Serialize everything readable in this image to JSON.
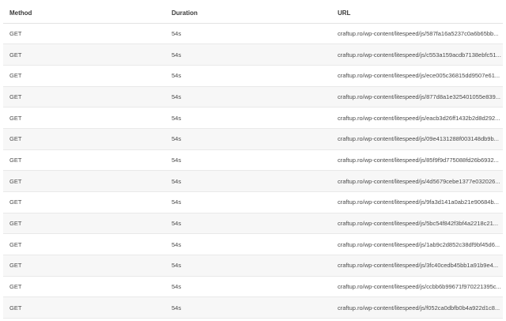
{
  "table": {
    "headers": {
      "method": "Method",
      "duration": "Duration",
      "url": "URL"
    },
    "rows": [
      {
        "method": "GET",
        "duration": "54s",
        "url": "craftup.ro/wp-content/litespeed/js/587fa16a5237c0a6b65bb..."
      },
      {
        "method": "GET",
        "duration": "54s",
        "url": "craftup.ro/wp-content/litespeed/js/c553a159acdb7138ebfc51..."
      },
      {
        "method": "GET",
        "duration": "54s",
        "url": "craftup.ro/wp-content/litespeed/js/ece005c36815dd9507e61..."
      },
      {
        "method": "GET",
        "duration": "54s",
        "url": "craftup.ro/wp-content/litespeed/js/877d8a1e325401055e839..."
      },
      {
        "method": "GET",
        "duration": "54s",
        "url": "craftup.ro/wp-content/litespeed/js/eacb3d26ff1432b2d8d292..."
      },
      {
        "method": "GET",
        "duration": "54s",
        "url": "craftup.ro/wp-content/litespeed/js/09e4131288f003148db9b..."
      },
      {
        "method": "GET",
        "duration": "54s",
        "url": "craftup.ro/wp-content/litespeed/js/85f9f9d775088fd26b6932..."
      },
      {
        "method": "GET",
        "duration": "54s",
        "url": "craftup.ro/wp-content/litespeed/js/4d5679cebe1377e032026..."
      },
      {
        "method": "GET",
        "duration": "54s",
        "url": "craftup.ro/wp-content/litespeed/js/9fa3d141a0ab21e90684b..."
      },
      {
        "method": "GET",
        "duration": "54s",
        "url": "craftup.ro/wp-content/litespeed/js/5bc54f842f3bf4a2218c21..."
      },
      {
        "method": "GET",
        "duration": "54s",
        "url": "craftup.ro/wp-content/litespeed/js/1ab9c2d852c38df9bf45d6..."
      },
      {
        "method": "GET",
        "duration": "54s",
        "url": "craftup.ro/wp-content/litespeed/js/3fc40cedb45bb1a91b9e4..."
      },
      {
        "method": "GET",
        "duration": "54s",
        "url": "craftup.ro/wp-content/litespeed/js/ccbb6b99671f970221395c..."
      },
      {
        "method": "GET",
        "duration": "54s",
        "url": "craftup.ro/wp-content/litespeed/js/f052ca0dbfb0b4a922d1c8..."
      }
    ]
  }
}
